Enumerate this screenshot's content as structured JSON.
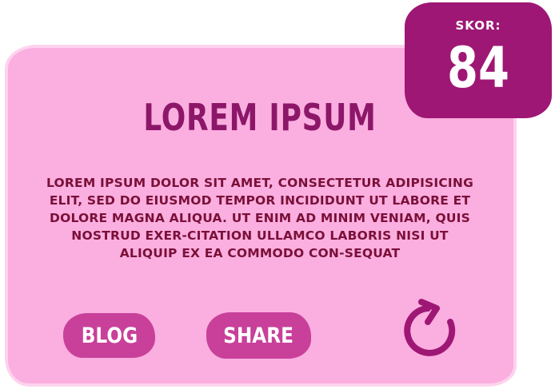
{
  "card": {
    "title": "LOREM IPSUM",
    "body": "LOREM IPSUM DOLOR SIT AMET, CONSECTETUR ADIPISICING ELIT, SED DO EIUSMOD TEMPOR INCIDIDUNT UT LABORE ET DOLORE MAGNA ALIQUA. UT ENIM AD MINIM VENIAM, QUIS NOSTRUD EXER-CITATION ULLAMCO LABORIS NISI UT ALIQUIP EX EA COMMODO CON-SEQUAT"
  },
  "buttons": {
    "blog_label": "BLOG",
    "share_label": "SHARE",
    "reload_icon": "reload-icon"
  },
  "score": {
    "label": "SKOR:",
    "value": "84"
  },
  "colors": {
    "card_background": "#fbaee0",
    "score_background": "#9e1774",
    "button_background": "#c8409a",
    "title_color": "#8c1769",
    "text_color": "#7a1038",
    "icon_color": "#9e1774"
  }
}
